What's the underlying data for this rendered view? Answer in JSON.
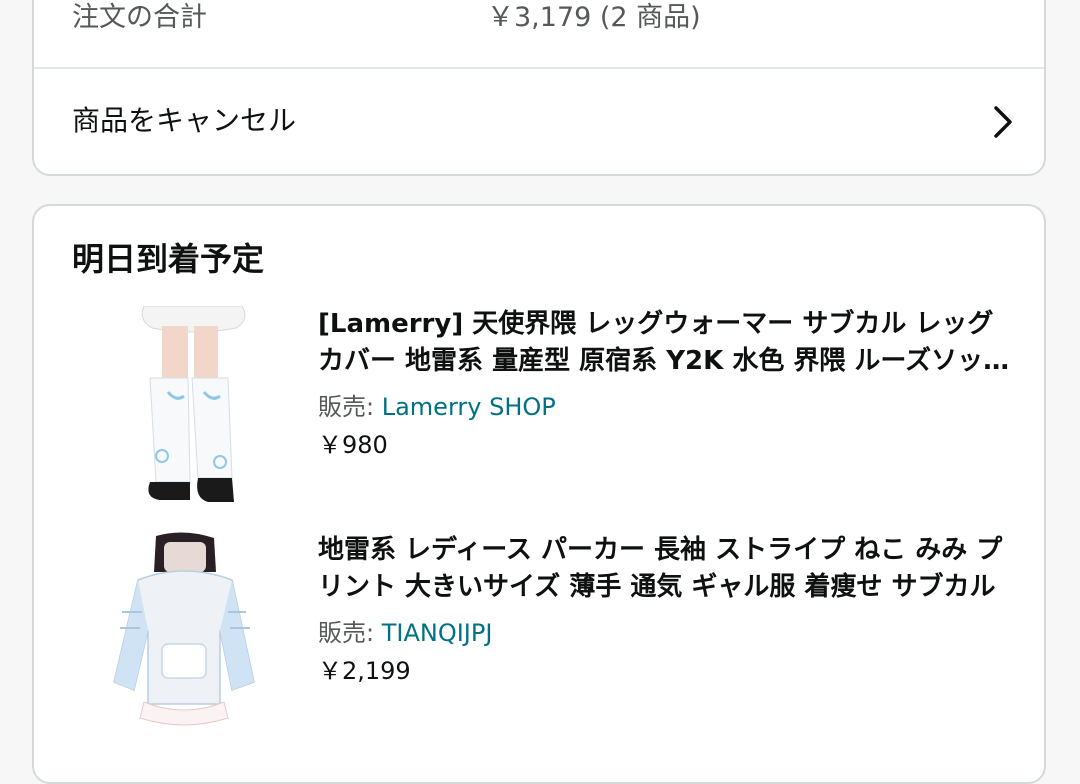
{
  "order_summary": {
    "total_label": "注文の合計",
    "total_value": "￥3,179 (2 商品)",
    "cancel_label": "商品をキャンセル"
  },
  "delivery": {
    "title": "明日到着予定",
    "items": [
      {
        "title": "[Lamerry] 天使界隈 レッグウォーマー サブカル レッグカバー 地雷系 量産型 原宿系 Y2K 水色 界隈 ルーズソックス",
        "seller_prefix": "販売: ",
        "seller": "Lamerry SHOP",
        "price": "￥980"
      },
      {
        "title": "地雷系 レディース パーカー 長袖 ストライプ ねこ みみ プリント 大きいサイズ 薄手 通気 ギャル服 着痩せ サブカル",
        "seller_prefix": "販売: ",
        "seller": "TIANQIJPJ",
        "price": "￥2,199"
      }
    ]
  },
  "icons": {
    "cancel_chevron": "chevron-right-icon"
  },
  "colors": {
    "link": "#007185",
    "muted_text": "#565959",
    "border": "#d5d9d9"
  }
}
